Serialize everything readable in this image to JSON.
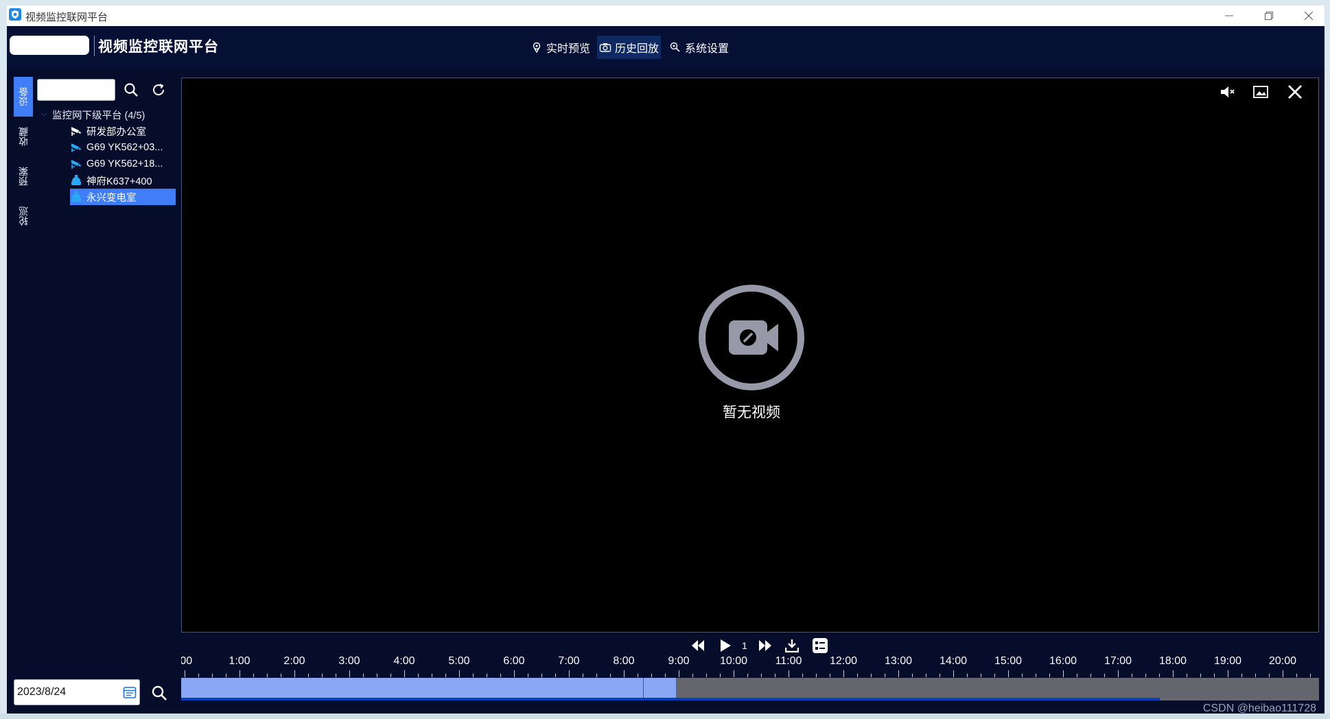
{
  "titlebar": {
    "title": "视频监控联网平台"
  },
  "header": {
    "app_title": "视频监控联网平台",
    "nav": [
      {
        "label": "实时预览",
        "icon": "location-pin-icon",
        "active": false
      },
      {
        "label": "历史回放",
        "icon": "camera-icon",
        "active": true
      },
      {
        "label": "系统设置",
        "icon": "settings-icon",
        "active": false
      }
    ]
  },
  "sidebar": {
    "tabs": [
      {
        "label": "设备",
        "active": true
      },
      {
        "label": "收藏",
        "active": false
      },
      {
        "label": "预案",
        "active": false
      },
      {
        "label": "轮巡",
        "active": false
      }
    ],
    "search": {
      "value": "",
      "placeholder": ""
    },
    "tree": {
      "root_label": "监控网下级平台 (4/5)",
      "items": [
        {
          "label": "研发部办公室",
          "icon": "camera-icon",
          "selected": false
        },
        {
          "label": "G69 YK562+03...",
          "icon": "camera-icon",
          "selected": false
        },
        {
          "label": "G69 YK562+18...",
          "icon": "camera-icon",
          "selected": false
        },
        {
          "label": "神府K637+400",
          "icon": "dome-camera-icon",
          "selected": false
        },
        {
          "label": "永兴变电室",
          "icon": "dome-camera-icon",
          "selected": true
        }
      ]
    }
  },
  "player": {
    "no_video_text": "暂无视频"
  },
  "controls": {
    "speed": "1"
  },
  "timeline": {
    "labels": [
      ":00",
      "1:00",
      "2:00",
      "3:00",
      "4:00",
      "5:00",
      "6:00",
      "7:00",
      "8:00",
      "9:00",
      "10:00",
      "11:00",
      "12:00",
      "13:00",
      "14:00",
      "15:00",
      "16:00",
      "17:00",
      "18:00",
      "19:00",
      "20:00"
    ],
    "recorded_until_hour": 8.95,
    "cursor_hour": 8.35,
    "progress_fraction": 0.86
  },
  "date": {
    "value": "2023/8/24"
  },
  "watermark": "CSDN @heibao111728",
  "colors": {
    "accent": "#3f7ef7",
    "header_bg": "#061034",
    "recorded": "#8aa7f5",
    "cursor": "#d3143a"
  }
}
